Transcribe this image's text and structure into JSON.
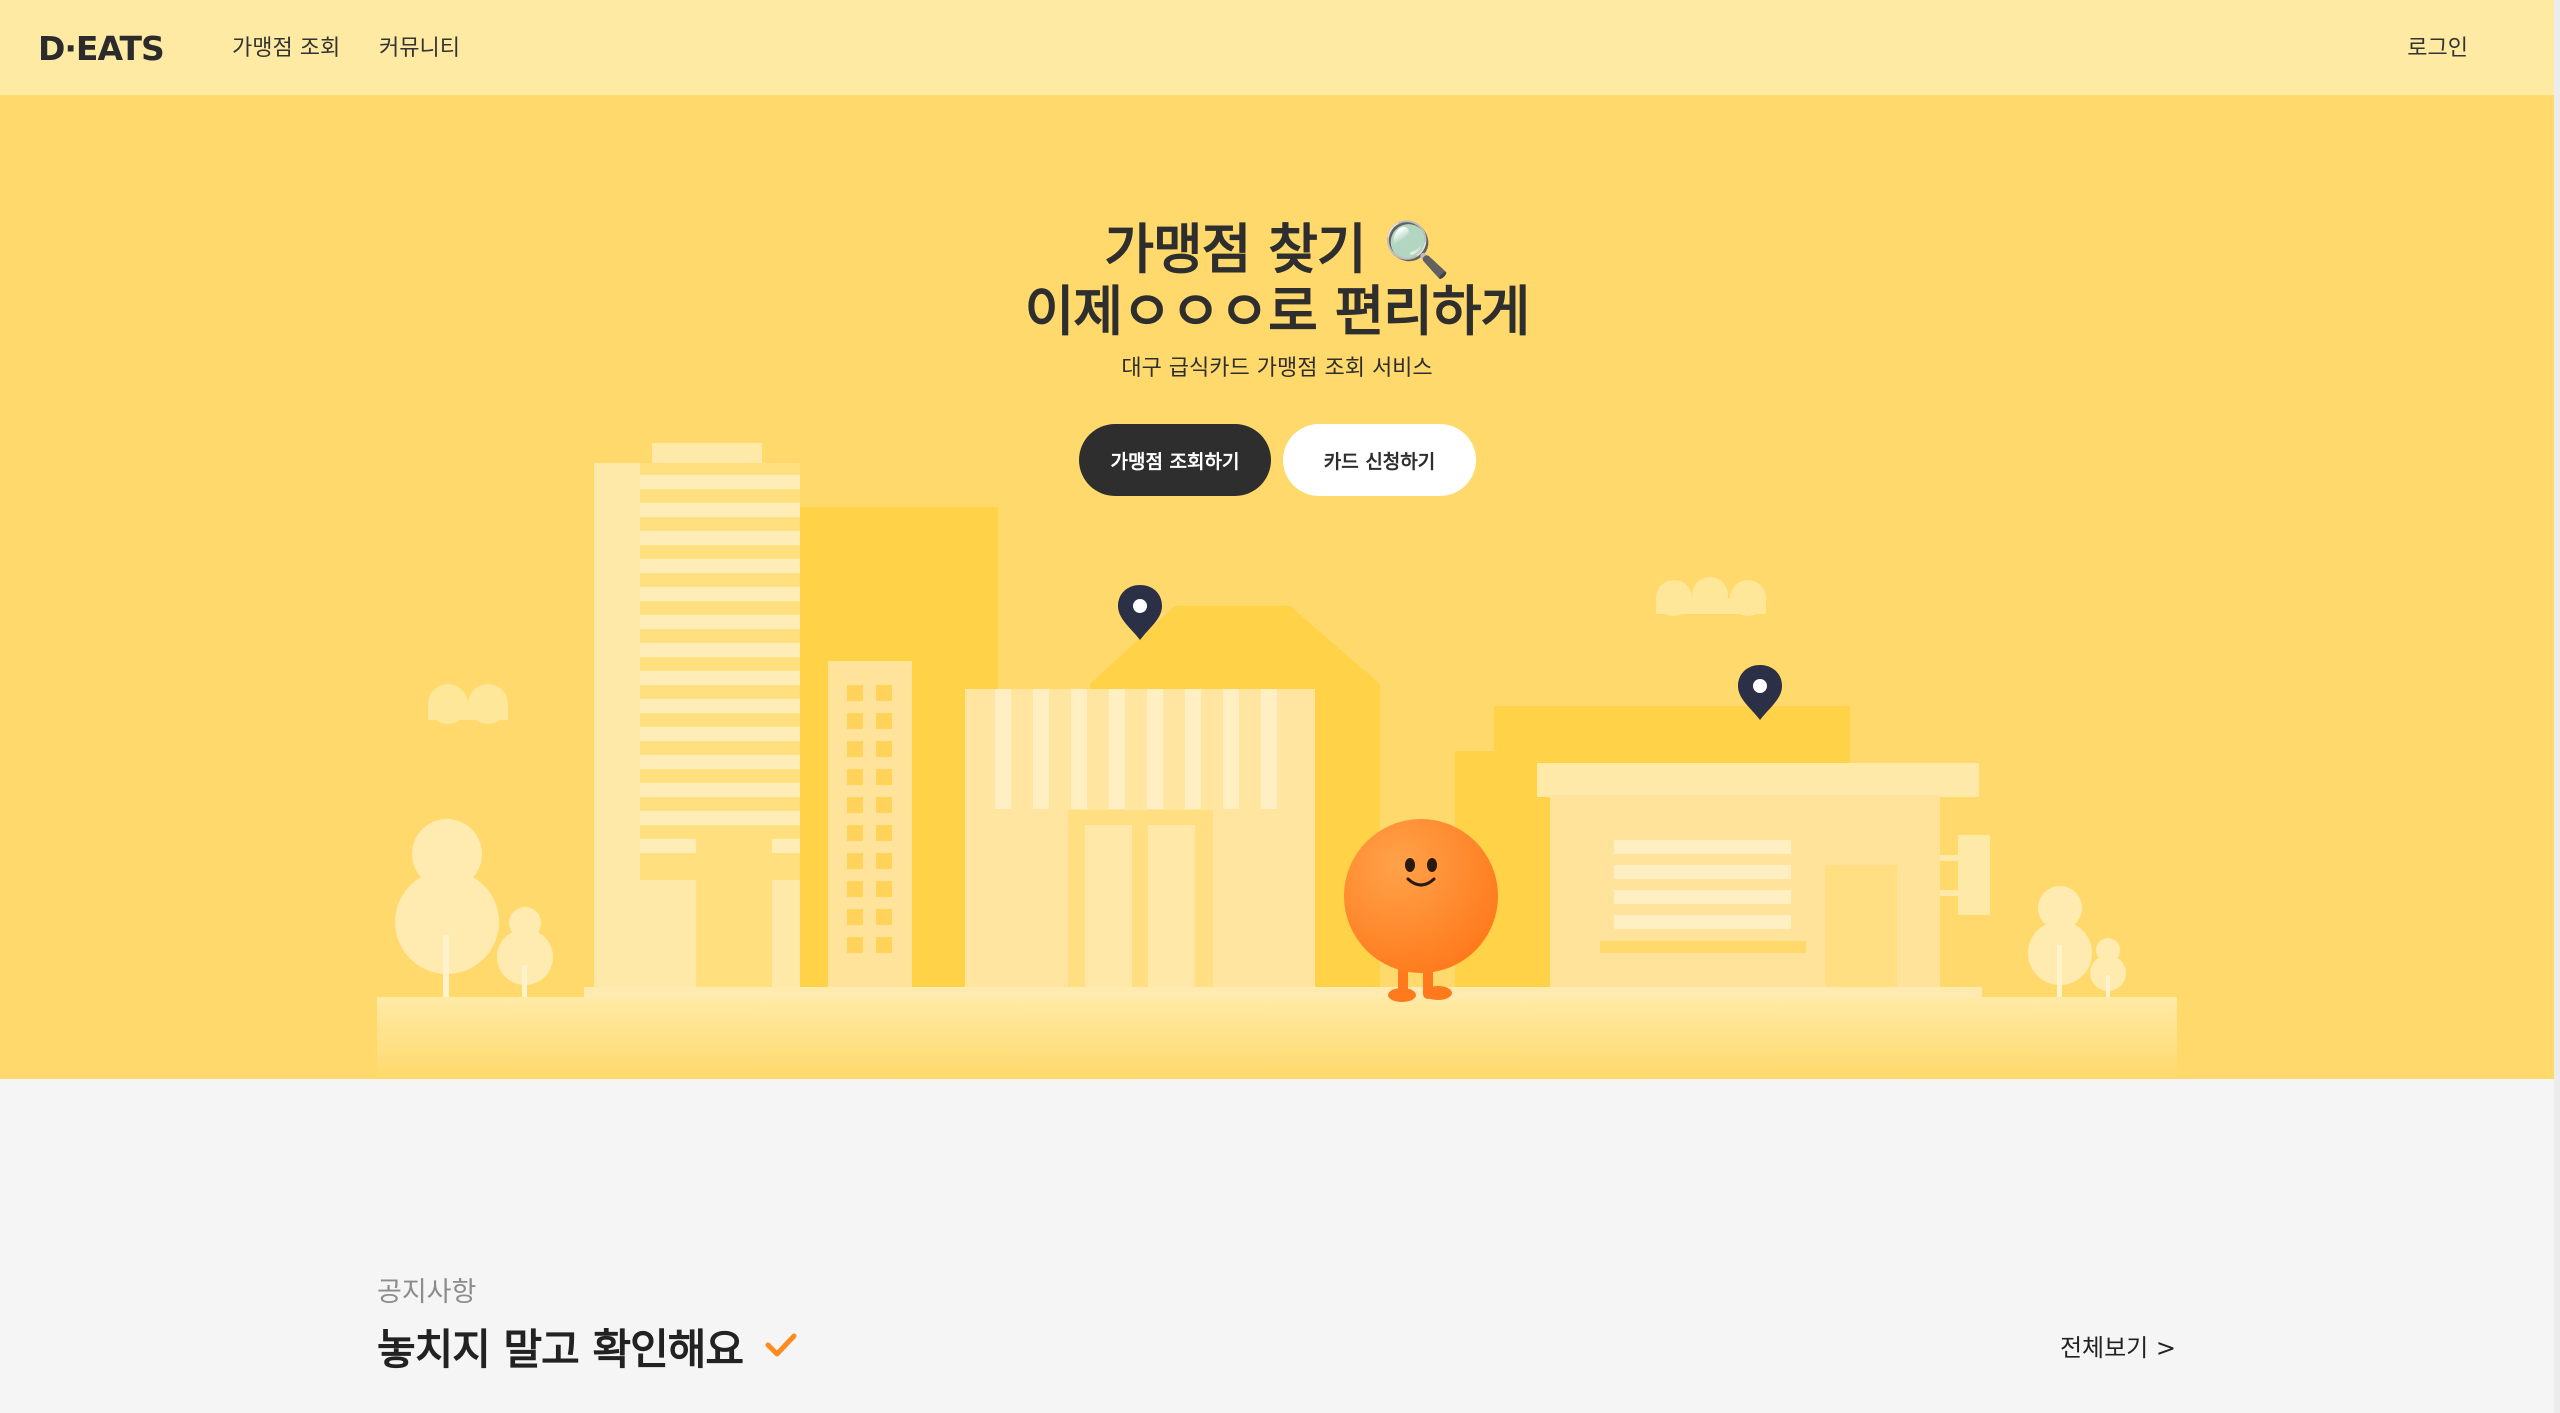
{
  "nav": {
    "logo_text": "D·EATS",
    "links": [
      {
        "label": "가맹점 조회"
      },
      {
        "label": "커뮤니티"
      }
    ],
    "login_label": "로그인"
  },
  "hero": {
    "title_line1": "가맹점 찾기 🔍",
    "title_line2": "이제ㅇㅇㅇ로 편리하게",
    "subtitle": "대구 급식카드 가맹점 조회 서비스",
    "primary_button": "가맹점 조회하기",
    "secondary_button": "카드 신청하기"
  },
  "notice": {
    "label": "공지사항",
    "title": "놓치지 말고 확인해요",
    "view_all": "전체보기 >"
  },
  "colors": {
    "nav_bg": "#ffeaa4",
    "hero_bg": "#ffd96b",
    "primary_button": "#2e2e2e",
    "mascot": "#ff8a2a",
    "pin": "#2c3046",
    "check": "#ff8a1f"
  },
  "icons": [
    "magnifier-icon",
    "location-pin-icon",
    "check-icon",
    "mascot-character"
  ]
}
